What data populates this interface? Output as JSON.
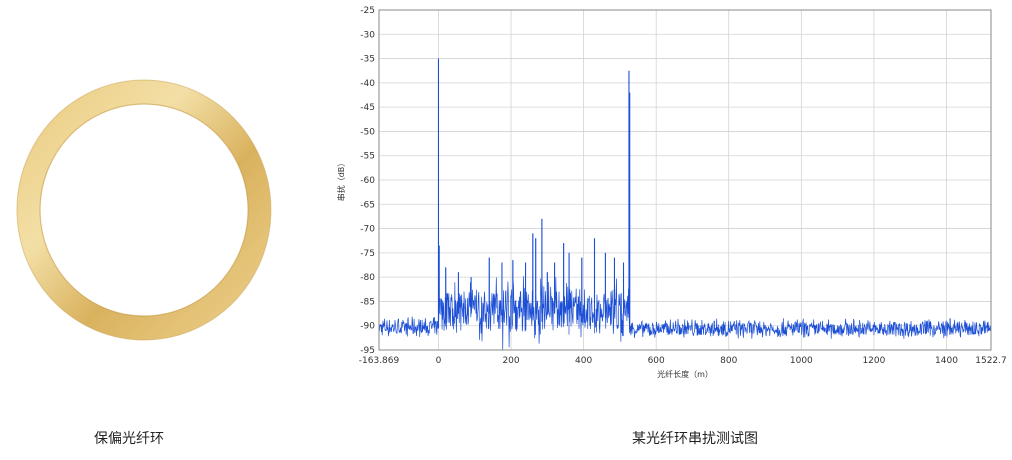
{
  "captions": {
    "left": "保偏光纤环",
    "right": "某光纤环串扰测试图"
  },
  "colors": {
    "ring_light": "#eed392",
    "ring_mid": "#d8b058",
    "ring_dark": "#b58d38",
    "series": "#1c4fd6",
    "grid": "#d3d3d3"
  },
  "chart_data": {
    "type": "line",
    "xlabel": "光纤长度（m）",
    "ylabel": "串扰（dB）",
    "xlim": [
      -163.869,
      1522.7
    ],
    "ylim": [
      -95,
      -25
    ],
    "xticks": [
      -163.869,
      0,
      200,
      400,
      600,
      800,
      1000,
      1200,
      1400,
      1522.7
    ],
    "xtick_labels": [
      "-163.869",
      "0",
      "200",
      "400",
      "600",
      "800",
      "1000",
      "1200",
      "1400",
      "1522.7"
    ],
    "yticks": [
      -25,
      -30,
      -35,
      -40,
      -45,
      -50,
      -55,
      -60,
      -65,
      -70,
      -75,
      -80,
      -85,
      -90,
      -95
    ],
    "grid": true,
    "series": [
      {
        "color": "#1c4fd6",
        "noise_floor": [
          {
            "x_from": -163.869,
            "x_to": 0,
            "level": -90.5
          },
          {
            "x_from": 0,
            "x_to": 525,
            "level": -87.5
          },
          {
            "x_from": 525,
            "x_to": 1522.7,
            "level": -90.8
          }
        ],
        "peaks": [
          {
            "x": 0,
            "y": -35
          },
          {
            "x": 2,
            "y": -73.5
          },
          {
            "x": 20,
            "y": -78
          },
          {
            "x": 55,
            "y": -79
          },
          {
            "x": 90,
            "y": -80
          },
          {
            "x": 140,
            "y": -76
          },
          {
            "x": 175,
            "y": -77
          },
          {
            "x": 205,
            "y": -76.5
          },
          {
            "x": 240,
            "y": -77
          },
          {
            "x": 260,
            "y": -71
          },
          {
            "x": 268,
            "y": -72
          },
          {
            "x": 285,
            "y": -68
          },
          {
            "x": 300,
            "y": -79
          },
          {
            "x": 320,
            "y": -77
          },
          {
            "x": 345,
            "y": -73
          },
          {
            "x": 360,
            "y": -75
          },
          {
            "x": 395,
            "y": -76
          },
          {
            "x": 430,
            "y": -72
          },
          {
            "x": 460,
            "y": -75
          },
          {
            "x": 485,
            "y": -76
          },
          {
            "x": 510,
            "y": -77
          },
          {
            "x": 525,
            "y": -37.5
          },
          {
            "x": 527,
            "y": -42
          },
          {
            "x": 760,
            "y": -89
          },
          {
            "x": 1410,
            "y": -88.5
          }
        ]
      }
    ]
  }
}
